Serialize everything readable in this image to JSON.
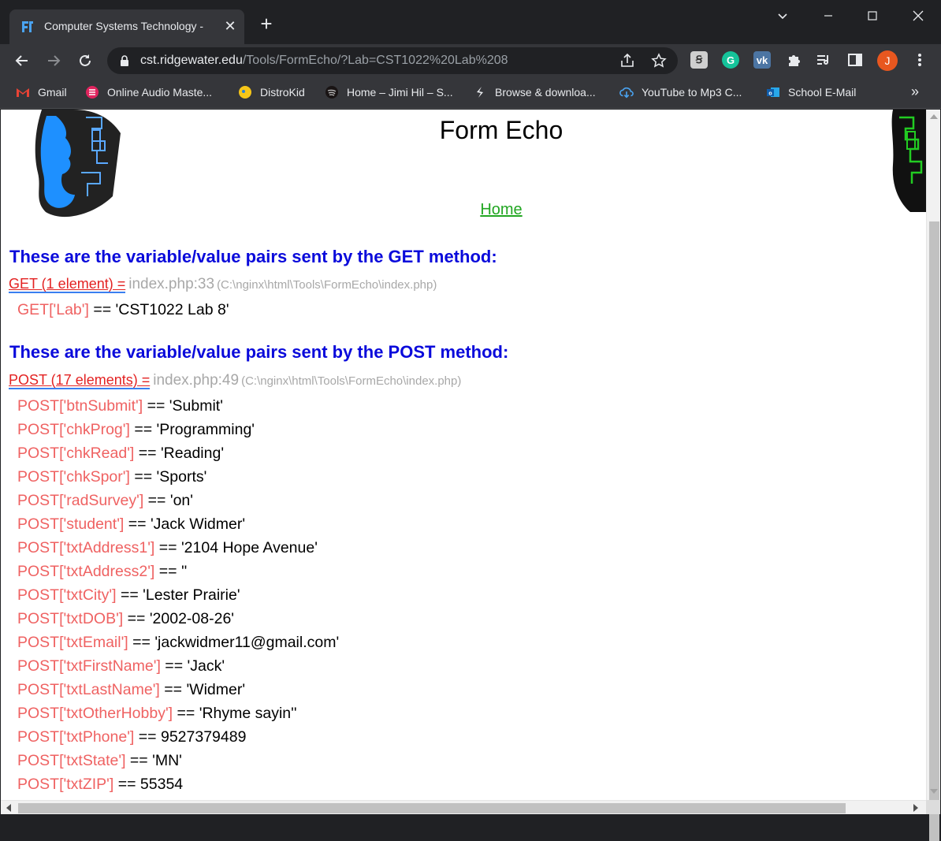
{
  "browser": {
    "tab_title": "Computer Systems Technology -",
    "url_domain": "cst.ridgewater.edu",
    "url_path": "/Tools/FormEcho/?Lab=CST1022%20Lab%208",
    "avatar_letter": "J",
    "bookmarks": [
      {
        "label": "Gmail",
        "icon": "gmail-icon"
      },
      {
        "label": "Online Audio Maste...",
        "icon": "audio-master-icon"
      },
      {
        "label": "DistroKid",
        "icon": "distrokid-icon"
      },
      {
        "label": "Home – Jimi Hil – S...",
        "icon": "spotify-icon"
      },
      {
        "label": "Browse & downloa...",
        "icon": "splice-icon"
      },
      {
        "label": "YouTube to Mp3 C...",
        "icon": "cloud-download-icon"
      },
      {
        "label": "School E-Mail",
        "icon": "outlook-icon"
      }
    ]
  },
  "page": {
    "title": "Form Echo",
    "home_link": "Home",
    "get_section": {
      "heading": "These are the variable/value pairs sent by the GET method:",
      "dump_label": "GET (1 element) =",
      "dump_location": "index.php:33",
      "dump_path": "(C:\\nginx\\html\\Tools\\FormEcho\\index.php)",
      "rows": [
        {
          "key": "GET['Lab']",
          "value": " == 'CST1022 Lab 8'"
        }
      ]
    },
    "post_section": {
      "heading": "These are the variable/value pairs sent by the POST method:",
      "dump_label": "POST (17 elements) =",
      "dump_location": "index.php:49",
      "dump_path": "(C:\\nginx\\html\\Tools\\FormEcho\\index.php)",
      "rows": [
        {
          "key": "POST['btnSubmit']",
          "value": " == 'Submit'"
        },
        {
          "key": "POST['chkProg']",
          "value": " == 'Programming'"
        },
        {
          "key": "POST['chkRead']",
          "value": " == 'Reading'"
        },
        {
          "key": "POST['chkSpor']",
          "value": " == 'Sports'"
        },
        {
          "key": "POST['radSurvey']",
          "value": " == 'on'"
        },
        {
          "key": "POST['student']",
          "value": " == 'Jack Widmer'"
        },
        {
          "key": "POST['txtAddress1']",
          "value": " == '2104 Hope Avenue'"
        },
        {
          "key": "POST['txtAddress2']",
          "value": " == ''"
        },
        {
          "key": "POST['txtCity']",
          "value": " == 'Lester Prairie'"
        },
        {
          "key": "POST['txtDOB']",
          "value": " == '2002-08-26'"
        },
        {
          "key": "POST['txtEmail']",
          "value": " == 'jackwidmer11@gmail.com'"
        },
        {
          "key": "POST['txtFirstName']",
          "value": " == 'Jack'"
        },
        {
          "key": "POST['txtLastName']",
          "value": " == 'Widmer'"
        },
        {
          "key": "POST['txtOtherHobby']",
          "value": " == 'Rhyme sayin''"
        },
        {
          "key": "POST['txtPhone']",
          "value": " == 9527379489"
        },
        {
          "key": "POST['txtState']",
          "value": " == 'MN'"
        },
        {
          "key": "POST['txtZIP']",
          "value": " == 55354"
        }
      ]
    }
  },
  "colors": {
    "heading": "#0a0adb",
    "dump_label": "#e32222",
    "key": "#ef6262",
    "link": "#22a622"
  }
}
